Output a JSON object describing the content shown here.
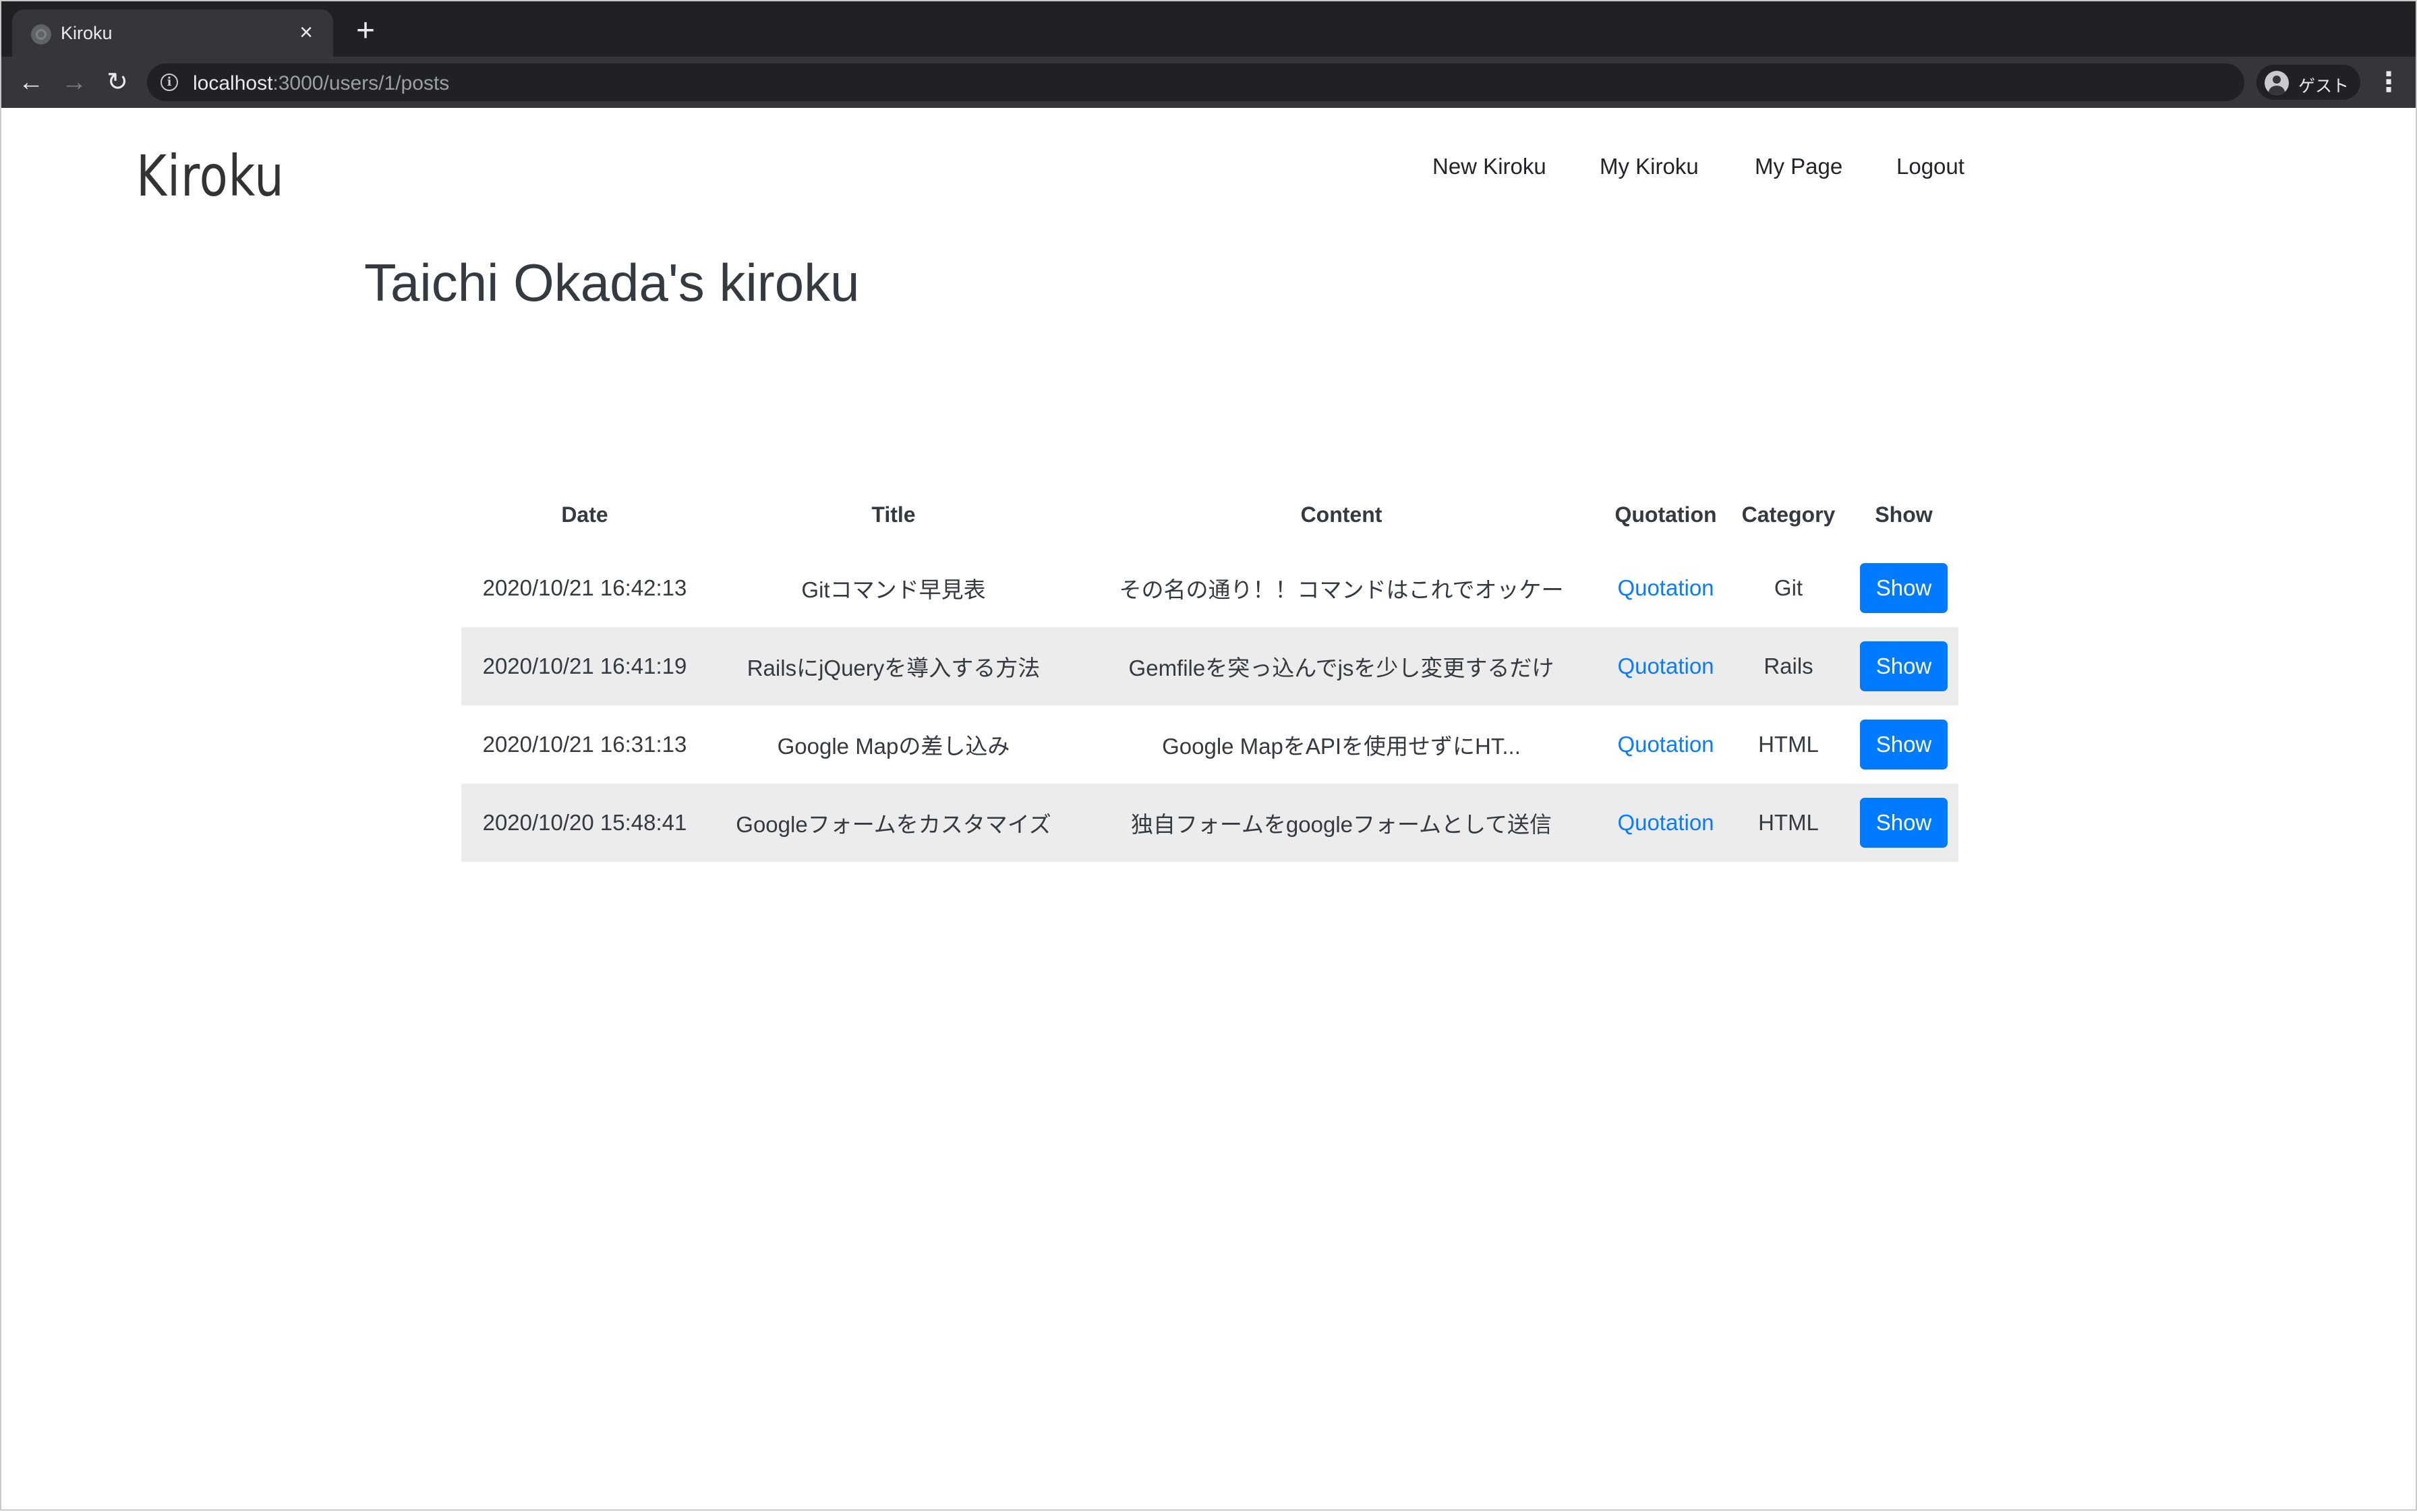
{
  "browser": {
    "tab_title": "Kiroku",
    "tab_close": "×",
    "new_tab": "+",
    "url_host": "localhost",
    "url_path": ":3000/users/1/posts",
    "profile_label": "ゲスト",
    "icons": {
      "back": "←",
      "forward": "→",
      "reload": "↻",
      "menu": "⋮",
      "info": "i"
    }
  },
  "header": {
    "brand": "Kiroku",
    "nav": [
      "New Kiroku",
      "My Kiroku",
      "My Page",
      "Logout"
    ]
  },
  "main": {
    "title": "Taichi Okada's kiroku",
    "table": {
      "columns": [
        "Date",
        "Title",
        "Content",
        "Quotation",
        "Category",
        "Show"
      ],
      "rows": [
        {
          "date": "2020/10/21 16:42:13",
          "title": "Gitコマンド早見表",
          "content": "その名の通り！！コマンドはこれでオッケー",
          "quotation": "Quotation",
          "category": "Git",
          "show": "Show"
        },
        {
          "date": "2020/10/21 16:41:19",
          "title": "RailsにjQueryを導入する方法",
          "content": "Gemfileを突っ込んでjsを少し変更するだけ",
          "quotation": "Quotation",
          "category": "Rails",
          "show": "Show"
        },
        {
          "date": "2020/10/21 16:31:13",
          "title": "Google Mapの差し込み",
          "content": "Google MapをAPIを使用せずにHT...",
          "quotation": "Quotation",
          "category": "HTML",
          "show": "Show"
        },
        {
          "date": "2020/10/20 15:48:41",
          "title": "Googleフォームをカスタマイズ",
          "content": "独自フォームをgoogleフォームとして送信",
          "quotation": "Quotation",
          "category": "HTML",
          "show": "Show"
        }
      ]
    }
  },
  "colors": {
    "primary": "#007bff",
    "link": "#0a7bff",
    "stripe": "#ececec",
    "text": "#343a40"
  }
}
